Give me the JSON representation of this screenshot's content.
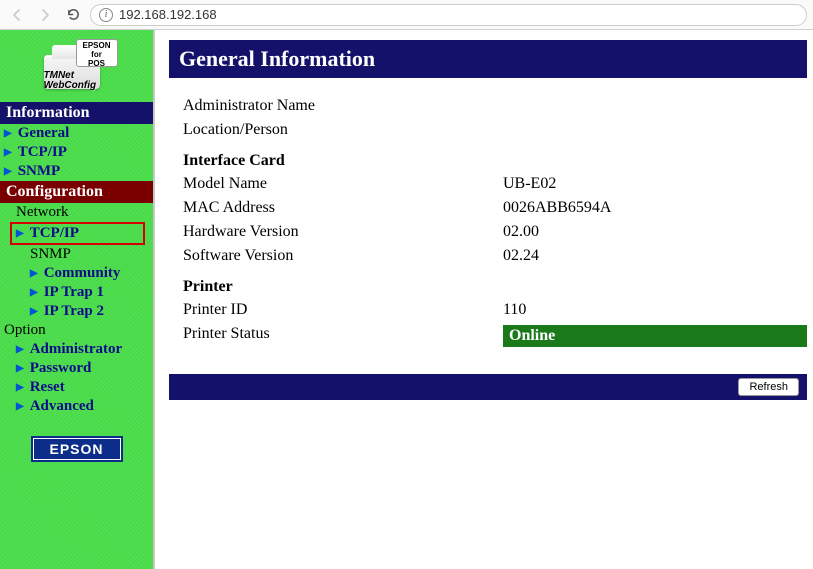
{
  "browser": {
    "url": "192.168.192.168"
  },
  "logo": {
    "badge_line1": "EPSON",
    "badge_line2": "for",
    "badge_line3": "POS",
    "tmnet_line1": "TMNet",
    "tmnet_line2": "WebConfig"
  },
  "sidebar": {
    "info_header": "Information",
    "info_items": [
      "General",
      "TCP/IP",
      "SNMP"
    ],
    "config_header": "Configuration",
    "network_label": "Network",
    "tcpip_label": "TCP/IP",
    "snmp_label": "SNMP",
    "snmp_items": [
      "Community",
      "IP Trap 1",
      "IP Trap 2"
    ],
    "option_label": "Option",
    "option_items": [
      "Administrator",
      "Password",
      "Reset",
      "Advanced"
    ]
  },
  "footer_brand": "EPSON",
  "main": {
    "title": "General Information",
    "admin_name_label": "Administrator Name",
    "admin_name_value": "",
    "location_label": "Location/Person",
    "location_value": "",
    "interface_card": {
      "header": "Interface Card",
      "model_label": "Model Name",
      "model_value": "UB-E02",
      "mac_label": "MAC Address",
      "mac_value": "0026ABB6594A",
      "hw_label": "Hardware Version",
      "hw_value": "02.00",
      "sw_label": "Software Version",
      "sw_value": "02.24"
    },
    "printer": {
      "header": "Printer",
      "id_label": "Printer ID",
      "id_value": "110",
      "status_label": "Printer Status",
      "status_value": "Online"
    },
    "refresh_label": "Refresh"
  }
}
